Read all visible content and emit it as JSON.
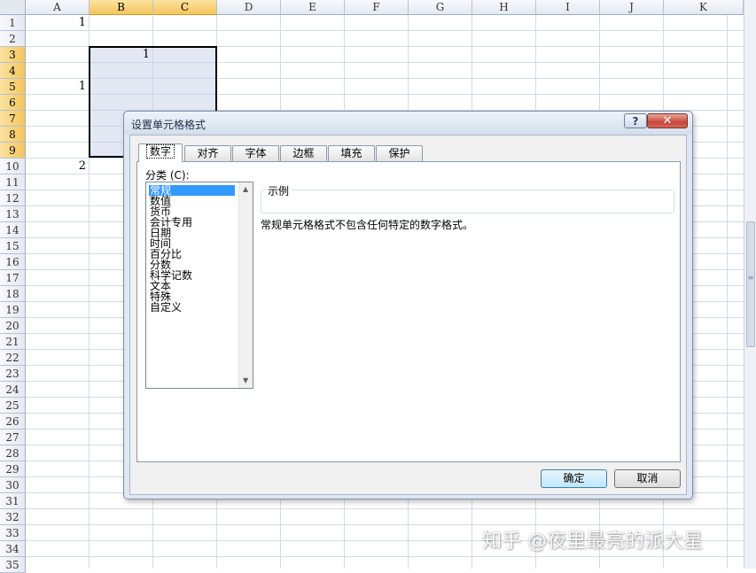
{
  "sheet": {
    "columns": [
      "A",
      "B",
      "C",
      "D",
      "E",
      "F",
      "G",
      "H",
      "I",
      "J",
      "K"
    ],
    "rows": [
      "1",
      "2",
      "3",
      "4",
      "5",
      "6",
      "7",
      "8",
      "9",
      "10",
      "11",
      "12",
      "13",
      "14",
      "15",
      "16",
      "17",
      "18",
      "19",
      "20",
      "21",
      "22",
      "23",
      "24",
      "25",
      "26",
      "27",
      "28",
      "29",
      "30",
      "31",
      "32",
      "33",
      "34",
      "35"
    ],
    "cells": {
      "a1": "1",
      "b3": "1",
      "a5": "1",
      "a10": "2"
    }
  },
  "dialog": {
    "title": "设置单元格格式",
    "help_label": "?",
    "close_label": "✕",
    "tabs": [
      "数字",
      "对齐",
      "字体",
      "边框",
      "填充",
      "保护"
    ],
    "category_label": "分类 (C):",
    "categories": [
      "常规",
      "数值",
      "货币",
      "会计专用",
      "日期",
      "时间",
      "百分比",
      "分数",
      "科学记数",
      "文本",
      "特殊",
      "自定义"
    ],
    "selected_category": "常规",
    "sample_label": "示例",
    "description": "常规单元格格式不包含任何特定的数字格式。",
    "ok_label": "确定",
    "cancel_label": "取消"
  },
  "watermark": "知乎 @夜里最亮的派大星"
}
